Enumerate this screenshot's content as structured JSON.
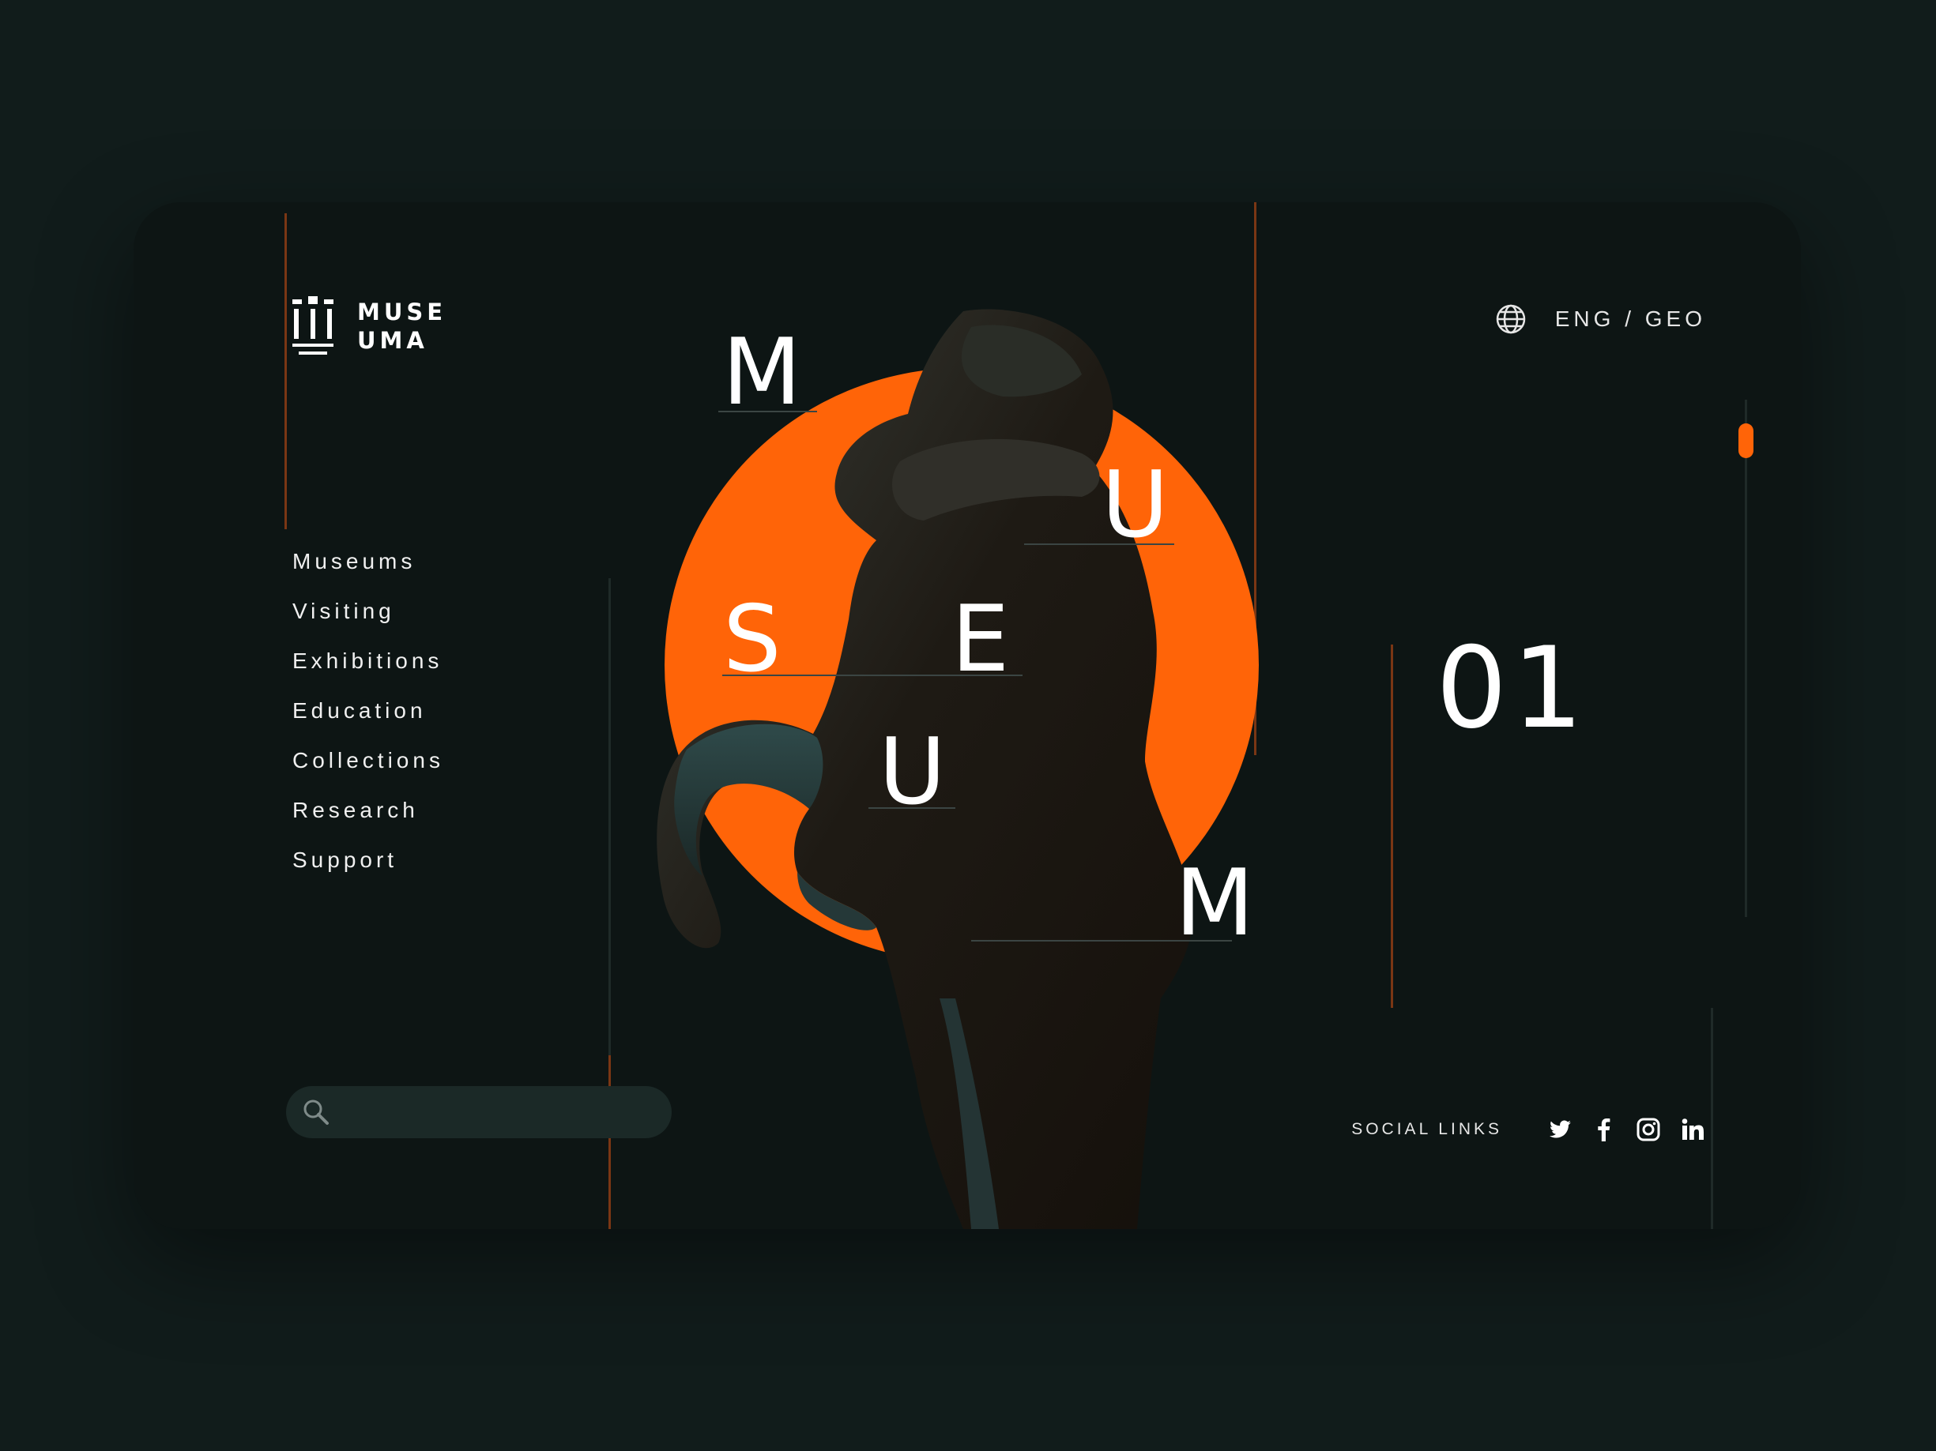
{
  "brand": {
    "line1": "MUSE",
    "line2": "UMA"
  },
  "language": {
    "label": "ENG / GEO",
    "icon": "globe-icon"
  },
  "nav": {
    "items": [
      {
        "label": "Museums"
      },
      {
        "label": "Visiting"
      },
      {
        "label": "Exhibitions"
      },
      {
        "label": "Education"
      },
      {
        "label": "Collections"
      },
      {
        "label": "Research"
      },
      {
        "label": "Support"
      }
    ]
  },
  "search": {
    "placeholder": "",
    "icon": "search-icon"
  },
  "hero": {
    "letters": [
      "M",
      "U",
      "S",
      "E",
      "U",
      "M"
    ],
    "slide_number": "01",
    "accent_color": "#ff6408"
  },
  "social": {
    "label": "SOCIAL LINKS",
    "icons": [
      "twitter-icon",
      "facebook-icon",
      "instagram-icon",
      "linkedin-icon"
    ]
  },
  "colors": {
    "background": "#111c1b",
    "card": "#0d1514",
    "accent": "#ff6408",
    "text": "#ffffff"
  }
}
